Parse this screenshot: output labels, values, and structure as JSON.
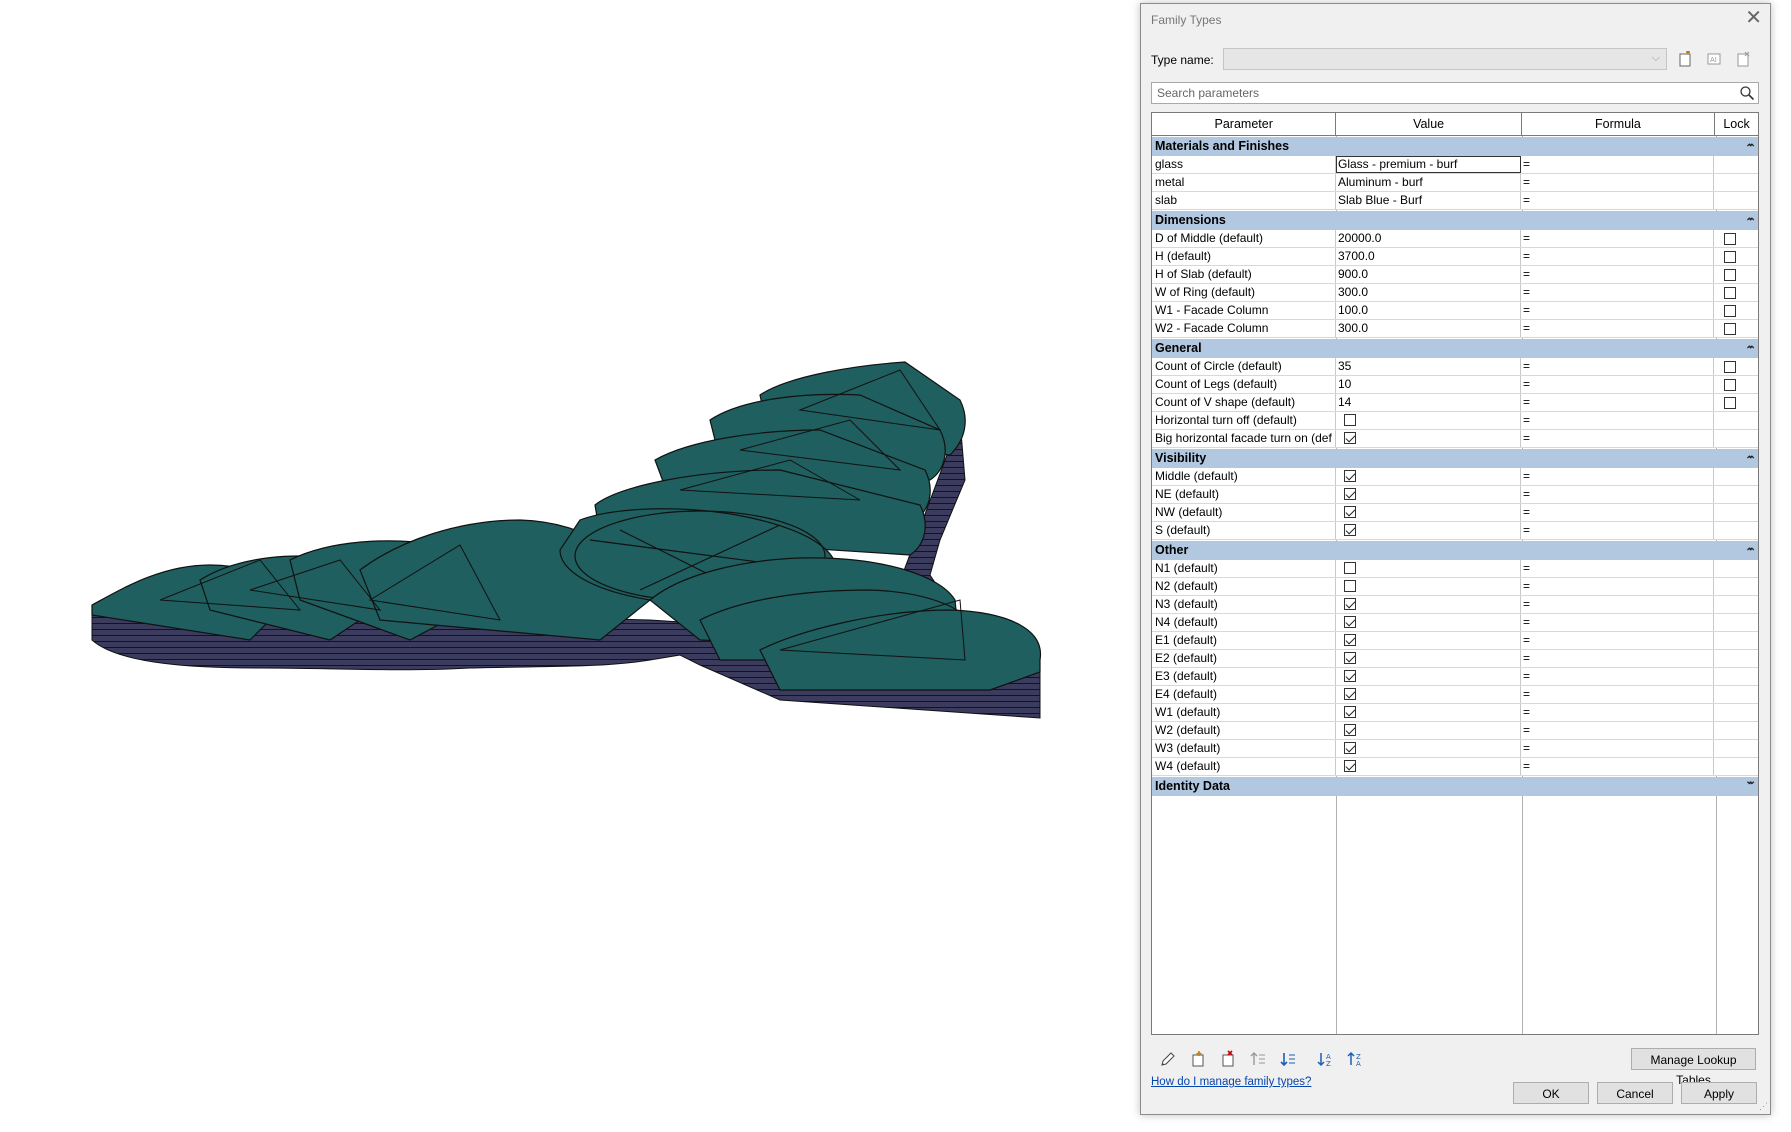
{
  "dialog": {
    "title": "Family Types",
    "type_name_label": "Type name:",
    "type_name_value": "",
    "search_placeholder": "Search parameters",
    "columns": {
      "parameter": "Parameter",
      "value": "Value",
      "formula": "Formula",
      "lock": "Lock"
    },
    "groups": [
      {
        "name": "Materials and Finishes",
        "collapsed": false,
        "rows": [
          {
            "param": "glass",
            "value": "Glass - premium - burf",
            "formula": "=",
            "lock": null,
            "selected": true
          },
          {
            "param": "metal",
            "value": "Aluminum - burf",
            "formula": "=",
            "lock": null
          },
          {
            "param": "slab",
            "value": "Slab Blue - Burf",
            "formula": "=",
            "lock": null
          }
        ]
      },
      {
        "name": "Dimensions",
        "collapsed": false,
        "rows": [
          {
            "param": "D of Middle (default)",
            "value": "20000.0",
            "formula": "=",
            "lock": false
          },
          {
            "param": "H (default)",
            "value": "3700.0",
            "formula": "=",
            "lock": false
          },
          {
            "param": "H of Slab (default)",
            "value": "900.0",
            "formula": "=",
            "lock": false
          },
          {
            "param": "W of Ring (default)",
            "value": "300.0",
            "formula": "=",
            "lock": false
          },
          {
            "param": "W1 - Facade Column",
            "value": "100.0",
            "formula": "=",
            "lock": false
          },
          {
            "param": "W2 - Facade Column",
            "value": "300.0",
            "formula": "=",
            "lock": false
          }
        ]
      },
      {
        "name": "General",
        "collapsed": false,
        "rows": [
          {
            "param": "Count of Circle (default)",
            "value": "35",
            "formula": "=",
            "lock": false
          },
          {
            "param": "Count of Legs (default)",
            "value": "10",
            "formula": "=",
            "lock": false
          },
          {
            "param": "Count of V shape (default)",
            "value": "14",
            "formula": "=",
            "lock": false
          },
          {
            "param": "Horizontal turn off (default)",
            "check": false,
            "formula": "=",
            "lock": null
          },
          {
            "param": "Big horizontal facade turn on (def",
            "check": true,
            "formula": "=",
            "lock": null
          }
        ]
      },
      {
        "name": "Visibility",
        "collapsed": false,
        "rows": [
          {
            "param": "Middle (default)",
            "check": true,
            "formula": "=",
            "lock": null
          },
          {
            "param": "NE (default)",
            "check": true,
            "formula": "=",
            "lock": null
          },
          {
            "param": "NW (default)",
            "check": true,
            "formula": "=",
            "lock": null
          },
          {
            "param": "S (default)",
            "check": true,
            "formula": "=",
            "lock": null
          }
        ]
      },
      {
        "name": "Other",
        "collapsed": false,
        "rows": [
          {
            "param": "N1 (default)",
            "check": false,
            "formula": "=",
            "lock": null
          },
          {
            "param": "N2 (default)",
            "check": false,
            "formula": "=",
            "lock": null
          },
          {
            "param": "N3 (default)",
            "check": true,
            "formula": "=",
            "lock": null
          },
          {
            "param": "N4 (default)",
            "check": true,
            "formula": "=",
            "lock": null
          },
          {
            "param": "E1 (default)",
            "check": true,
            "formula": "=",
            "lock": null
          },
          {
            "param": "E2 (default)",
            "check": true,
            "formula": "=",
            "lock": null
          },
          {
            "param": "E3 (default)",
            "check": true,
            "formula": "=",
            "lock": null
          },
          {
            "param": "E4 (default)",
            "check": true,
            "formula": "=",
            "lock": null
          },
          {
            "param": "W1 (default)",
            "check": true,
            "formula": "=",
            "lock": null
          },
          {
            "param": "W2 (default)",
            "check": true,
            "formula": "=",
            "lock": null
          },
          {
            "param": "W3 (default)",
            "check": true,
            "formula": "=",
            "lock": null
          },
          {
            "param": "W4 (default)",
            "check": true,
            "formula": "=",
            "lock": null
          }
        ]
      },
      {
        "name": "Identity Data",
        "collapsed": true,
        "rows": []
      }
    ],
    "bottom_icons": [
      "edit-parameter-icon",
      "new-parameter-icon",
      "delete-parameter-icon",
      "move-up-icon",
      "move-down-icon",
      "sort-ascending-icon",
      "sort-descending-icon"
    ],
    "manage_lookup_label": "Manage Lookup Tables",
    "help_link": "How do I manage family types?",
    "ok_label": "OK",
    "cancel_label": "Cancel",
    "apply_label": "Apply"
  },
  "colors": {
    "model_top": "#1f5f5f",
    "model_side": "#3a3a5c",
    "group_header": "#b2c8e0",
    "dialog_bg": "#f0f0f0"
  }
}
